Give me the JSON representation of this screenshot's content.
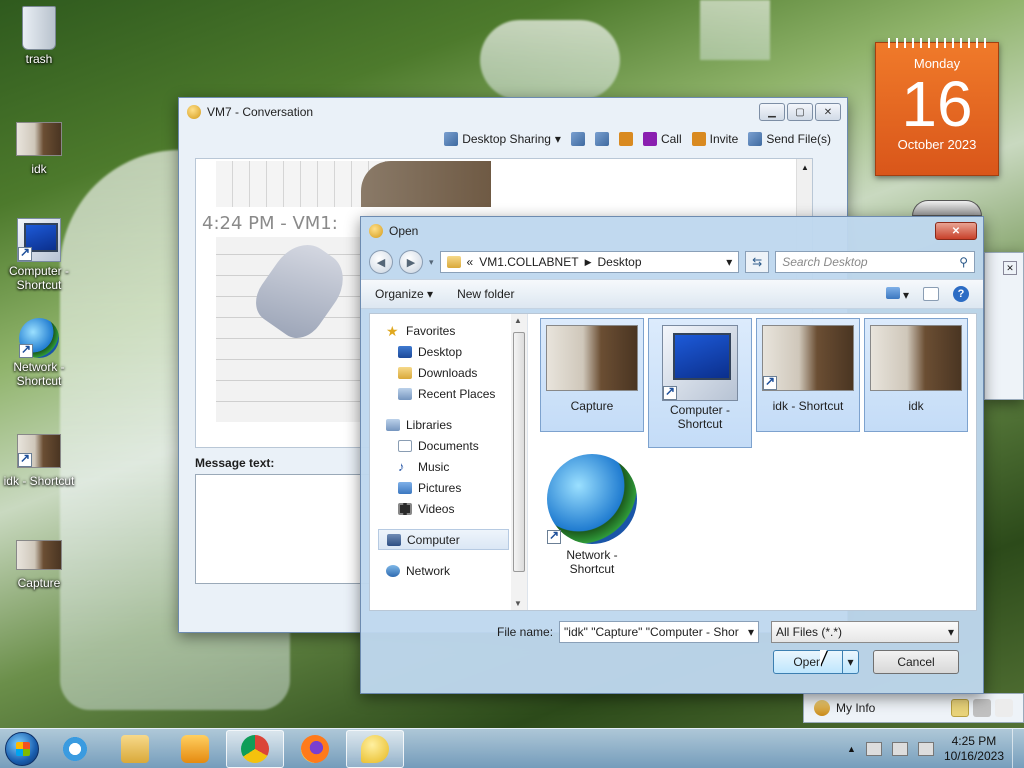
{
  "desktop": {
    "icons": [
      {
        "label": "trash",
        "kind": "recycle-bin"
      },
      {
        "label": "idk",
        "kind": "photo"
      },
      {
        "label": "Computer - Shortcut",
        "kind": "computer"
      },
      {
        "label": "Network - Shortcut",
        "kind": "network"
      },
      {
        "label": "idk - Shortcut",
        "kind": "photo-shortcut"
      },
      {
        "label": "Capture",
        "kind": "photo"
      }
    ]
  },
  "calendar": {
    "weekday": "Monday",
    "day": "16",
    "month_year": "October 2023"
  },
  "conversation": {
    "title": "VM7 - Conversation",
    "toolbar": {
      "desktop_sharing": "Desktop Sharing",
      "call": "Call",
      "invite": "Invite",
      "send_files": "Send File(s)"
    },
    "history_time": "4:24 PM - VM1:",
    "message_label": "Message text:"
  },
  "open_dialog": {
    "title": "Open",
    "breadcrumb": {
      "prefix": "«",
      "root": "VM1.COLLABNET",
      "folder": "Desktop"
    },
    "search_placeholder": "Search Desktop",
    "organize": "Organize",
    "new_folder": "New folder",
    "nav": {
      "favorites": "Favorites",
      "desktop": "Desktop",
      "downloads": "Downloads",
      "recent_places": "Recent Places",
      "libraries": "Libraries",
      "documents": "Documents",
      "music": "Music",
      "pictures": "Pictures",
      "videos": "Videos",
      "computer": "Computer",
      "network": "Network"
    },
    "files": [
      {
        "name": "Capture",
        "kind": "photo",
        "selected": true
      },
      {
        "name": "Computer - Shortcut",
        "kind": "computer",
        "selected": true
      },
      {
        "name": "idk - Shortcut",
        "kind": "photo",
        "selected": true
      },
      {
        "name": "idk",
        "kind": "photo",
        "selected": true
      },
      {
        "name": "Network - Shortcut",
        "kind": "network",
        "selected": false
      }
    ],
    "file_name_label": "File name:",
    "file_name_value": "\"idk\" \"Capture\" \"Computer - Shor",
    "file_type_value": "All Files (*.*)",
    "open_button": "Open",
    "cancel_button": "Cancel"
  },
  "messenger": {
    "my_info": "My Info"
  },
  "taskbar": {
    "clock_time": "4:25 PM",
    "clock_date": "10/16/2023",
    "pinned": [
      "internet-explorer",
      "file-explorer",
      "media-player",
      "chrome",
      "firefox",
      "messenger"
    ]
  }
}
